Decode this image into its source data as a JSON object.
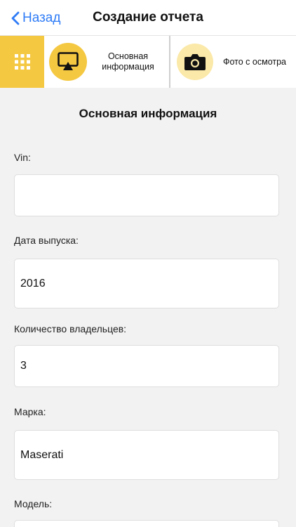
{
  "navbar": {
    "back_label": "Назад",
    "title": "Создание отчета"
  },
  "tabs": {
    "items": [
      {
        "label": "Основная информация",
        "icon": "airplay-icon",
        "active": true
      },
      {
        "label": "Фото с осмотра",
        "icon": "camera-icon",
        "active": false
      }
    ],
    "menu_icon": "grid-menu-icon"
  },
  "form": {
    "section_title": "Основная информация",
    "fields": [
      {
        "label": "Vin:",
        "value": ""
      },
      {
        "label": "Дата выпуска:",
        "value": "2016"
      },
      {
        "label": "Количество владельцев:",
        "value": "3"
      },
      {
        "label": "Марка:",
        "value": "Maserati"
      },
      {
        "label": "Модель:",
        "value": ""
      }
    ]
  },
  "colors": {
    "accent": "#f5c842",
    "link": "#2f7cf6",
    "background": "#f2f2f2"
  }
}
